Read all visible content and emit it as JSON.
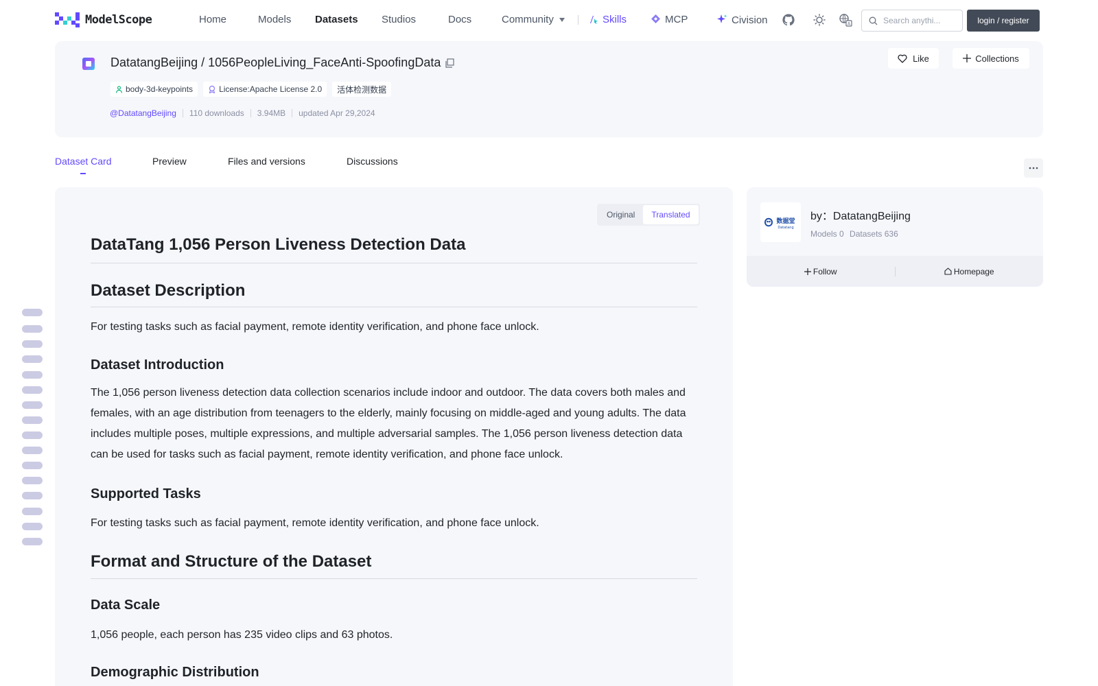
{
  "nav": {
    "logo_text": "ModelScope",
    "items": [
      "Home",
      "Models",
      "Datasets",
      "Studios",
      "Docs"
    ],
    "community": "Community",
    "skills": "Skills",
    "mcp": "MCP",
    "civision": "Civision",
    "search_placeholder": "Search anythi...",
    "login": "login / register",
    "accent": "#624aff"
  },
  "header": {
    "owner": "DatatangBeijing",
    "separator": "/",
    "name": "1056PeopleLiving_FaceAnti-SpoofingData",
    "tags": [
      "body-3d-keypoints",
      "License:Apache License 2.0",
      "活体检测数据"
    ],
    "author": "@DatatangBeijing",
    "downloads": "110 downloads",
    "size": "3.94MB",
    "updated": "updated Apr 29,2024",
    "like": "Like",
    "collections": "Collections"
  },
  "tabs": [
    "Dataset Card",
    "Preview",
    "Files and versions",
    "Discussions"
  ],
  "toggle": {
    "original": "Original",
    "translated": "Translated"
  },
  "doc": {
    "title": "DataTang 1,056 Person Liveness Detection Data",
    "desc_heading": "Dataset Description",
    "desc_text": "For testing tasks such as facial payment, remote identity verification, and phone face unlock.",
    "intro_heading": "Dataset Introduction",
    "intro_text": "The 1,056 person liveness detection data collection scenarios include indoor and outdoor. The data covers both males and females, with an age distribution from teenagers to the elderly, mainly focusing on middle-aged and young adults. The data includes multiple poses, multiple expressions, and multiple adversarial samples. The 1,056 person liveness detection data can be used for tasks such as facial payment, remote identity verification, and phone face unlock.",
    "tasks_heading": "Supported Tasks",
    "tasks_text": "For testing tasks such as facial payment, remote identity verification, and phone face unlock.",
    "format_heading": "Format and Structure of the Dataset",
    "scale_heading": "Data Scale",
    "scale_text": "1,056 people, each person has 235 video clips and 63 photos.",
    "demo_heading": "Demographic Distribution"
  },
  "author_card": {
    "by": "by：DatatangBeijing",
    "models": "Models 0",
    "datasets": "Datasets 636",
    "follow": "Follow",
    "homepage": "Homepage",
    "logo_text": "数据堂",
    "logo_sub": "Datatang"
  }
}
